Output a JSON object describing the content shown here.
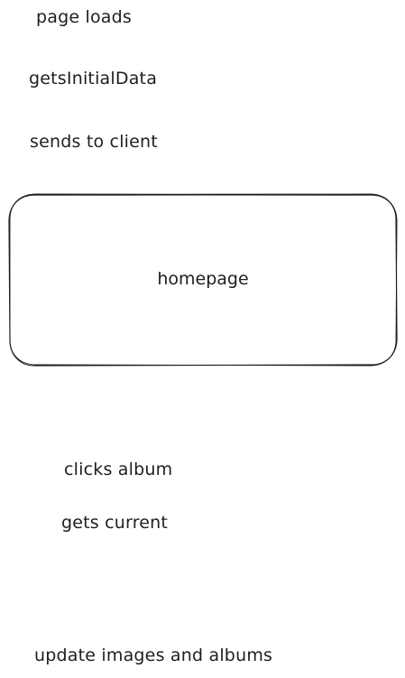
{
  "notes": {
    "page_loads": "page loads",
    "gets_initial_data": "getsInitialData",
    "sends_to_client": "sends to client",
    "clicks_album": "clicks album",
    "gets_current": "gets current",
    "update_images_albums": "update images and albums"
  },
  "homepage_box": {
    "label": "homepage"
  },
  "colors": {
    "stroke": "#1e1e1e",
    "background": "#ffffff"
  }
}
